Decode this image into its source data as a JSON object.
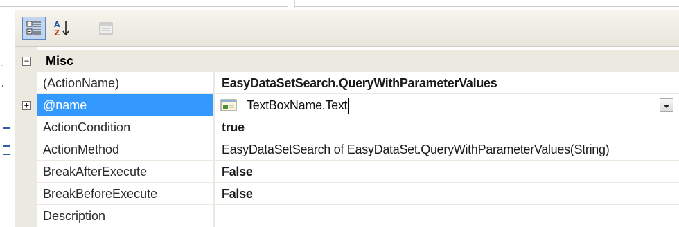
{
  "toolbar": {
    "categorized_icon": "categorized-icon",
    "alphabetical_icon": "alphabetical-sort-icon",
    "property_pages_icon": "property-pages-icon"
  },
  "category": {
    "label": "Misc",
    "expander": "⊟"
  },
  "rows": [
    {
      "name": "(ActionName)",
      "value": "EasyDataSetSearch.QueryWithParameterValues",
      "bold": true
    },
    {
      "name": "@name",
      "value": "TextBoxName.Text",
      "expander": "⊞",
      "selected": true
    },
    {
      "name": "ActionCondition",
      "value": "true",
      "bold": true
    },
    {
      "name": "ActionMethod",
      "value": "EasyDataSetSearch of EasyDataSet.QueryWithParameterValues(String)"
    },
    {
      "name": "BreakAfterExecute",
      "value": "False",
      "bold": true
    },
    {
      "name": "BreakBeforeExecute",
      "value": "False",
      "bold": true
    },
    {
      "name": "Description",
      "value": ""
    }
  ],
  "colors": {
    "selection": "#3399ff",
    "gutter": "#eceae0",
    "toolbar_active": "#c3d5ee"
  }
}
